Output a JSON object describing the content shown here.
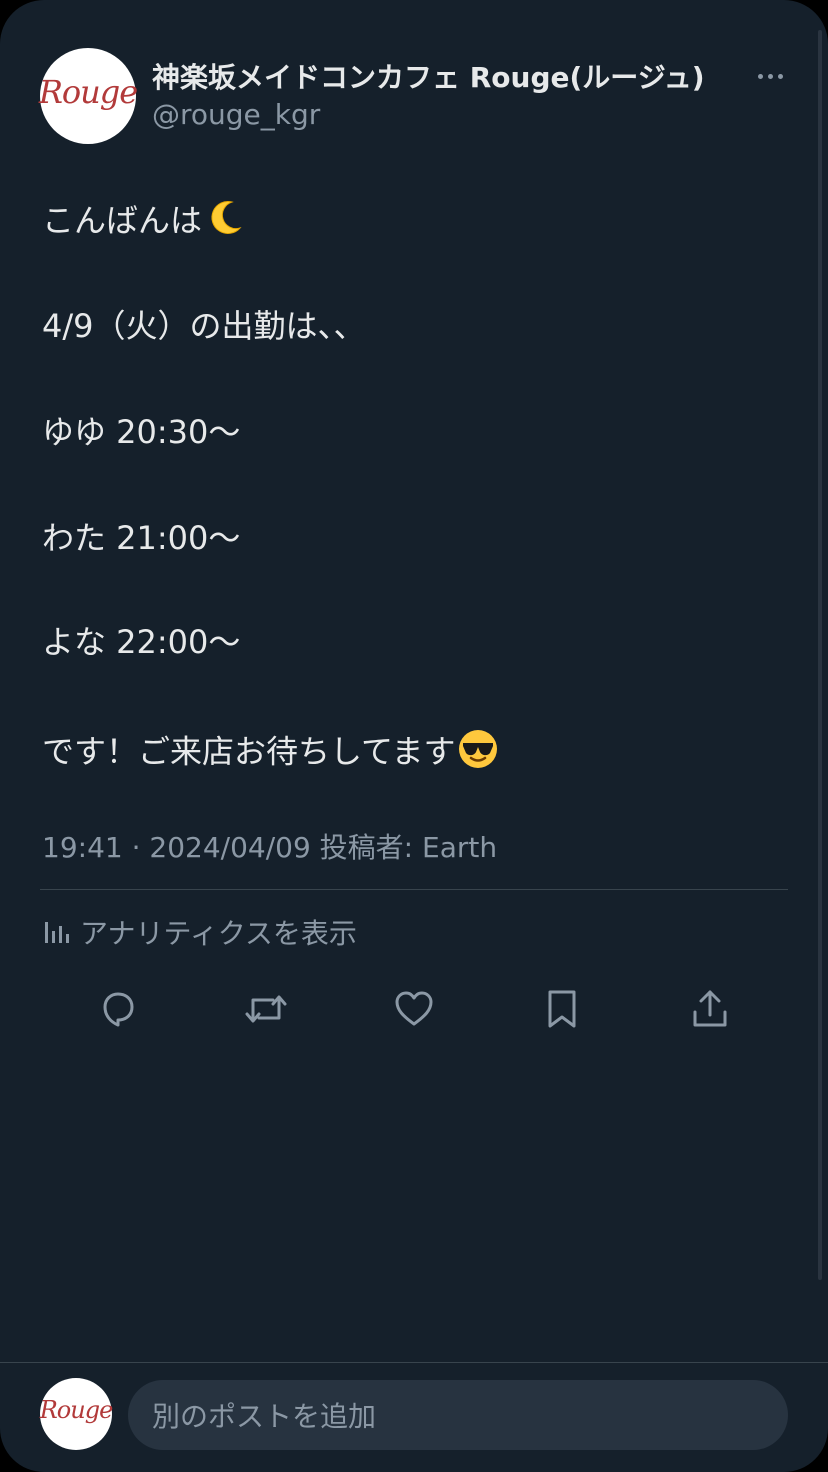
{
  "header": {
    "display_name": "神楽坂メイドコンカフェ Rouge(ルージュ)",
    "handle": "@rouge_kgr",
    "avatar_logo_text": "Rouge",
    "more_icon": "more-horizontal-icon"
  },
  "post": {
    "lines": [
      "こんばんは",
      "4/9（火）の出勤は、、",
      "ゆゆ 20:30〜",
      "わた 21:00〜",
      "よな 22:00〜",
      "です！ご来店お待ちしてます"
    ],
    "emoji": {
      "greeting": "crescent-moon-emoji",
      "closing": "smiling-face-with-sunglasses-emoji"
    },
    "meta": "19:41 · 2024/04/09 投稿者: Earth"
  },
  "analytics": {
    "label": "アナリティクスを表示",
    "icon": "bar-chart-icon"
  },
  "actions": [
    {
      "name": "reply",
      "icon": "reply-icon"
    },
    {
      "name": "repost",
      "icon": "repost-icon"
    },
    {
      "name": "like",
      "icon": "heart-icon"
    },
    {
      "name": "bookmark",
      "icon": "bookmark-icon"
    },
    {
      "name": "share",
      "icon": "share-icon"
    }
  ],
  "compose": {
    "placeholder": "別のポストを追加"
  },
  "colors": {
    "background": "#15202b",
    "text_primary": "#e7e9ea",
    "text_secondary": "#8b98a5",
    "divider": "#38444d",
    "brand_logo": "#b23a3a"
  }
}
